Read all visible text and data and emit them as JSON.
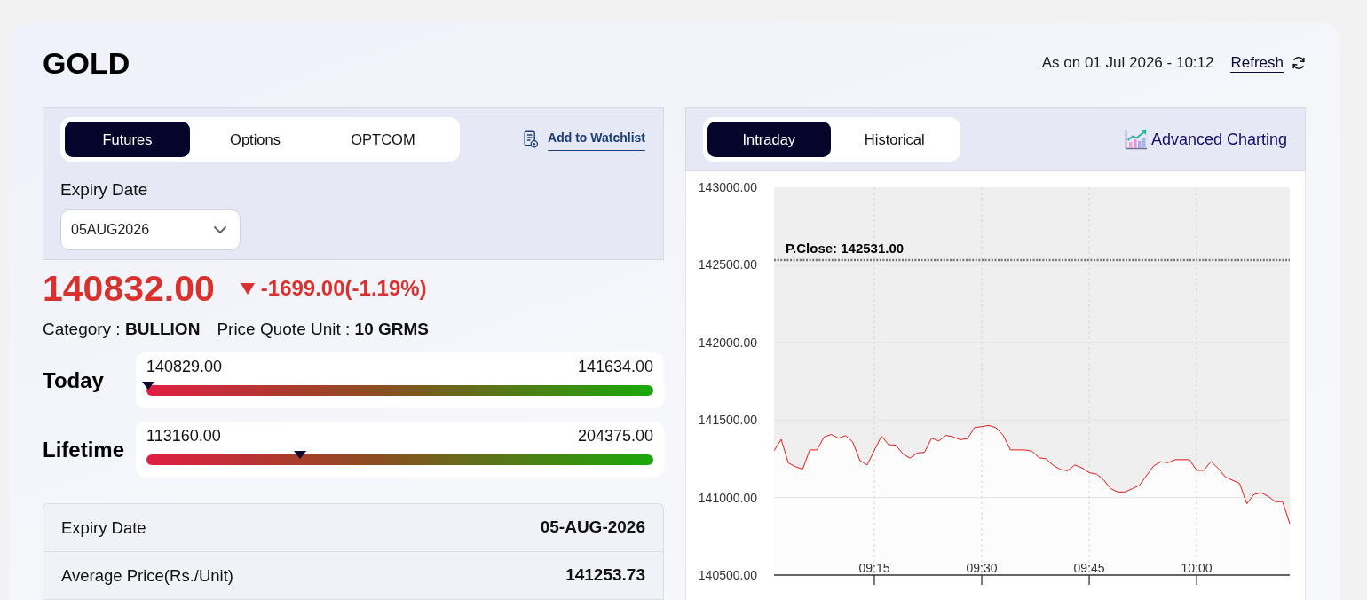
{
  "header": {
    "title": "GOLD",
    "as_on": "As on 01 Jul 2026 - 10:12",
    "refresh": "Refresh"
  },
  "contract_panel": {
    "tabs": [
      {
        "label": "Futures",
        "selected": true
      },
      {
        "label": "Options",
        "selected": false
      },
      {
        "label": "OPTCOM",
        "selected": false
      }
    ],
    "watchlist_link": "Add to Watchlist",
    "expiry_label": "Expiry Date",
    "expiry_value": "05AUG2026"
  },
  "quote": {
    "price": "140832.00",
    "falling": true,
    "change": "-1699.00(-1.19%)",
    "category": "Category : **BULLION**",
    "quote_unit": "Price Quote Unit : **10 GRMS**"
  },
  "ranges": [
    {
      "label": "Today",
      "low": "140829.00",
      "high": "141634.00",
      "level": 0.004
    },
    {
      "label": "Lifetime",
      "low": "113160.00",
      "high": "204375.00",
      "level": 0.303
    }
  ],
  "details": [
    {
      "label": "Expiry Date",
      "value": "05-AUG-2026"
    },
    {
      "label": "Average Price(Rs./Unit)",
      "value": "141253.73"
    }
  ],
  "chart_panel": {
    "tabs": [
      {
        "label": "Intraday",
        "selected": true
      },
      {
        "label": "Historical",
        "selected": false
      }
    ],
    "advanced_link": "Advanced Charting",
    "chart_data": {
      "type": "area",
      "x": [
        541,
        542,
        543,
        544,
        545,
        546,
        547,
        548,
        549,
        550,
        551,
        552,
        553,
        554,
        555,
        556,
        557,
        558,
        559,
        560,
        561,
        562,
        563,
        564,
        565,
        566,
        567,
        568,
        569,
        570,
        571,
        572,
        573,
        574,
        575,
        576,
        577,
        578,
        579,
        580,
        581,
        582,
        583,
        584,
        585,
        586,
        587,
        588,
        589,
        590,
        591,
        592,
        593,
        594,
        595,
        596,
        597,
        598,
        599,
        600,
        601,
        602,
        603,
        604,
        605,
        606,
        607,
        608,
        609,
        610,
        611,
        612,
        613
      ],
      "series": [
        {
          "color": "#e00000",
          "values": [
            141302,
            141375,
            141223,
            141199,
            141183,
            141307,
            141307,
            141391,
            141407,
            141383,
            141399,
            141357,
            141238,
            141210,
            141304,
            141396,
            141341,
            141338,
            141281,
            141254,
            141288,
            141291,
            141383,
            141365,
            141401,
            141391,
            141373,
            141380,
            141451,
            141457,
            141465,
            141449,
            141401,
            141307,
            141307,
            141307,
            141299,
            141257,
            141249,
            141207,
            141181,
            141173,
            141210,
            141191,
            141160,
            141152,
            141115,
            141057,
            141036,
            141036,
            141057,
            141078,
            141141,
            141204,
            141231,
            141225,
            141244,
            141244,
            141244,
            141175,
            141175,
            141233,
            141189,
            141133,
            141112,
            141091,
            140960,
            141020,
            141031,
            141007,
            140973,
            140973,
            140832
          ]
        }
      ],
      "xlim": [
        541,
        613
      ],
      "ylim": [
        140500,
        143000
      ],
      "xticks": [
        {
          "value": 555,
          "label": "09:15"
        },
        {
          "value": 570,
          "label": "09:30"
        },
        {
          "value": 585,
          "label": "09:45"
        },
        {
          "value": 600,
          "label": "10:00"
        }
      ],
      "yticks": [
        {
          "value": 143000,
          "label": "143000.00"
        },
        {
          "value": 142500,
          "label": "142500.00"
        },
        {
          "value": 142000,
          "label": "142000.00"
        },
        {
          "value": 141500,
          "label": "141500.00"
        },
        {
          "value": 141000,
          "label": "141000.00"
        },
        {
          "value": 140500,
          "label": "140500.00"
        }
      ],
      "grid": true,
      "ref_lines": [
        {
          "axis": "y",
          "value": 142531,
          "label": "P.Close: 142531.00"
        }
      ]
    }
  }
}
